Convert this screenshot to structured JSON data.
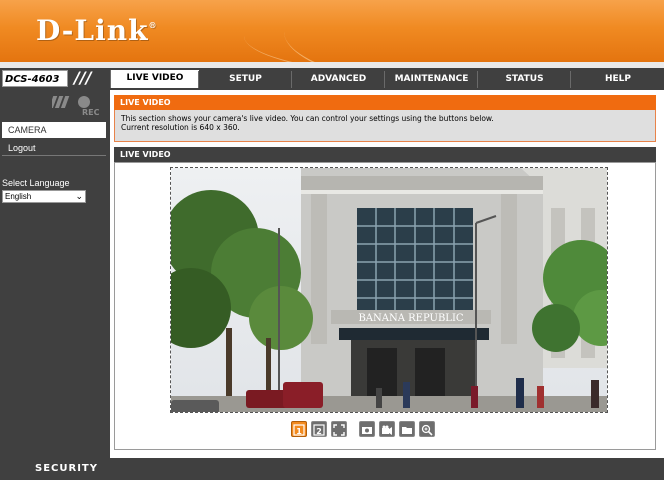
{
  "brand": {
    "logo": "D-Link",
    "registered_mark": "®"
  },
  "model": "DCS-4603",
  "nav": {
    "tabs": [
      {
        "label": "LIVE VIDEO",
        "active": true
      },
      {
        "label": "SETUP",
        "active": false
      },
      {
        "label": "ADVANCED",
        "active": false
      },
      {
        "label": "MAINTENANCE",
        "active": false
      },
      {
        "label": "STATUS",
        "active": false
      },
      {
        "label": "HELP",
        "active": false
      }
    ]
  },
  "sidebar": {
    "rec_label": "REC",
    "items": [
      {
        "label": "CAMERA"
      },
      {
        "label": "Logout"
      }
    ],
    "language_label": "Select Language",
    "language_value": "English"
  },
  "main": {
    "section_title": "LIVE VIDEO",
    "description_line1": "This section shows your camera's live video. You can control your settings using the buttons below.",
    "description_line2": "Current resolution is 640 x 360.",
    "live_title": "LIVE VIDEO",
    "video_sign_text": "BANANA REPUBLIC",
    "controls": [
      {
        "icon": "stream-1-icon",
        "label": "1"
      },
      {
        "icon": "stream-2-icon",
        "label": "2"
      },
      {
        "icon": "fullscreen-icon"
      },
      {
        "icon": "snapshot-icon"
      },
      {
        "icon": "record-icon"
      },
      {
        "icon": "storage-folder-icon"
      },
      {
        "icon": "digital-zoom-icon"
      }
    ]
  },
  "footer": {
    "label": "SECURITY"
  },
  "colors": {
    "accent": "#f06b10",
    "dark": "#404040",
    "header": "#f08a22"
  }
}
